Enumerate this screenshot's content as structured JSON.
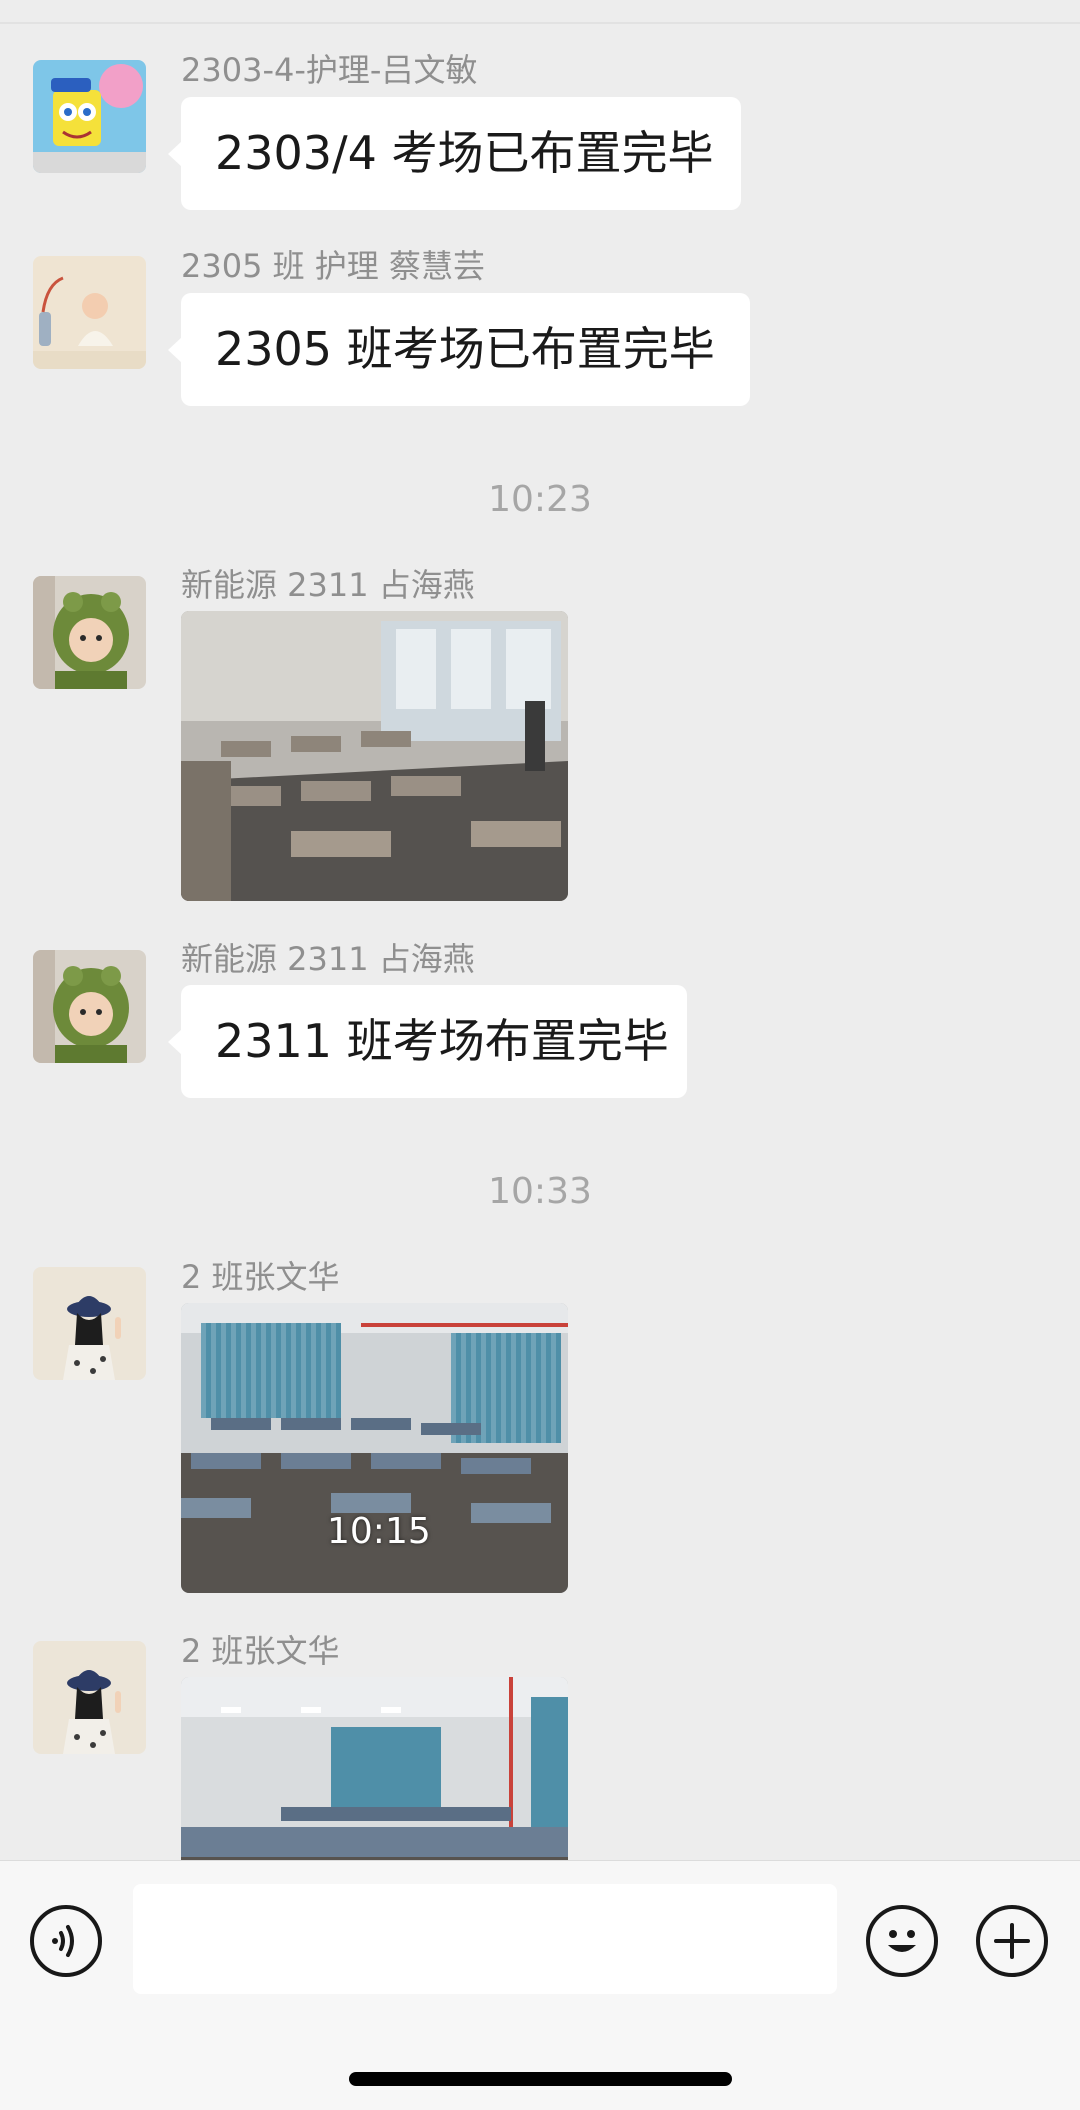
{
  "messages": [
    {
      "sender": "2303-4-护理-吕文敏",
      "text": "2303/4 考场已布置完毕"
    },
    {
      "sender": "2305 班 护理  蔡慧芸",
      "text": "2305 班考场已布置完毕"
    },
    {
      "timestamp": "10:23"
    },
    {
      "sender": "新能源 2311 占海燕",
      "image": "classroom-photo"
    },
    {
      "sender": "新能源 2311 占海燕",
      "text": "2311 班考场布置完毕"
    },
    {
      "timestamp": "10:33"
    },
    {
      "sender": "2 班张文华",
      "image": "classroom-photo",
      "image_stamp_time": "10:15"
    },
    {
      "sender": "2 班张文华",
      "image": "classroom-photo"
    }
  ],
  "input_bar": {
    "voice_icon": "voice-icon",
    "message_input_value": "",
    "emoji_icon": "emoji-icon",
    "plus_icon": "plus-icon"
  },
  "colors": {
    "background": "#ededed",
    "bubble": "#ffffff",
    "sender_text": "#8f8f8f",
    "timestamp_text": "#a6a6a6"
  }
}
